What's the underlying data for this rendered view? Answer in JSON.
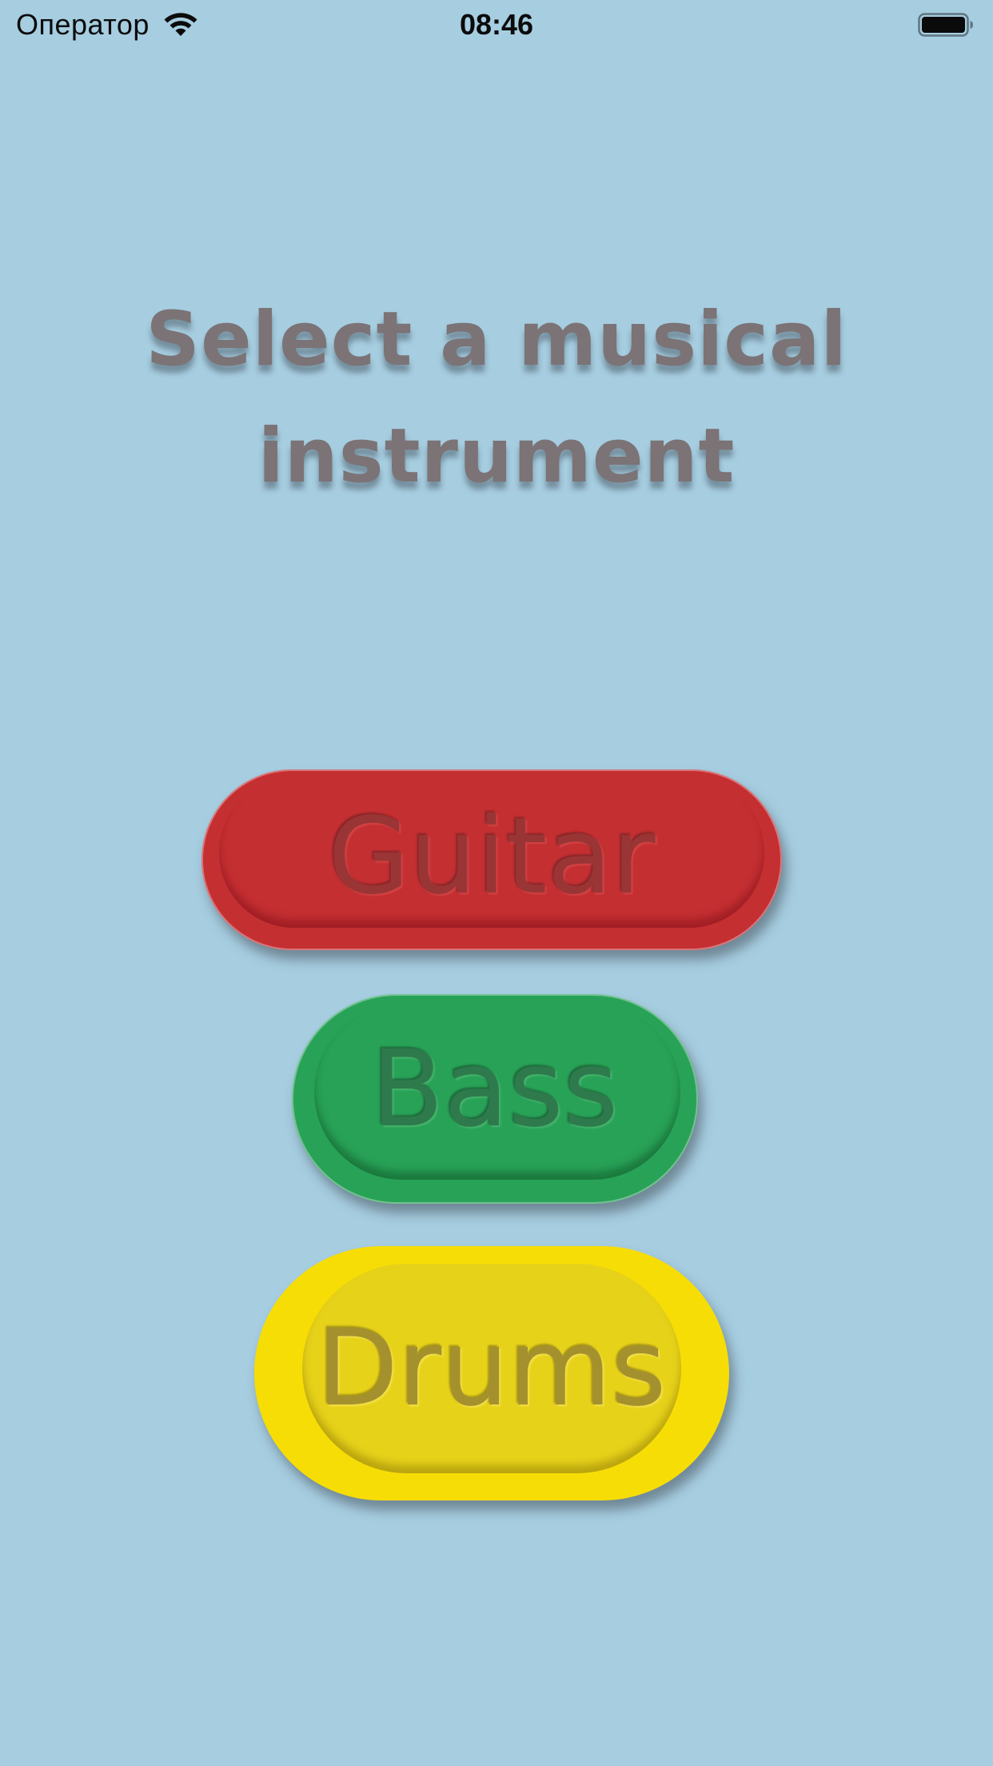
{
  "status_bar": {
    "carrier": "Оператор",
    "time": "08:46",
    "wifi_icon": "wifi-icon",
    "battery_icon": "battery-icon"
  },
  "main": {
    "heading_line1": "Select a musical",
    "heading_line2": "instrument",
    "buttons": [
      {
        "label": "Guitar",
        "color": "#c42f32"
      },
      {
        "label": "Bass",
        "color": "#28a257"
      },
      {
        "label": "Drums",
        "color": "#f7dd06"
      }
    ]
  },
  "colors": {
    "background": "#a6cde0",
    "heading": "#7b7376"
  }
}
